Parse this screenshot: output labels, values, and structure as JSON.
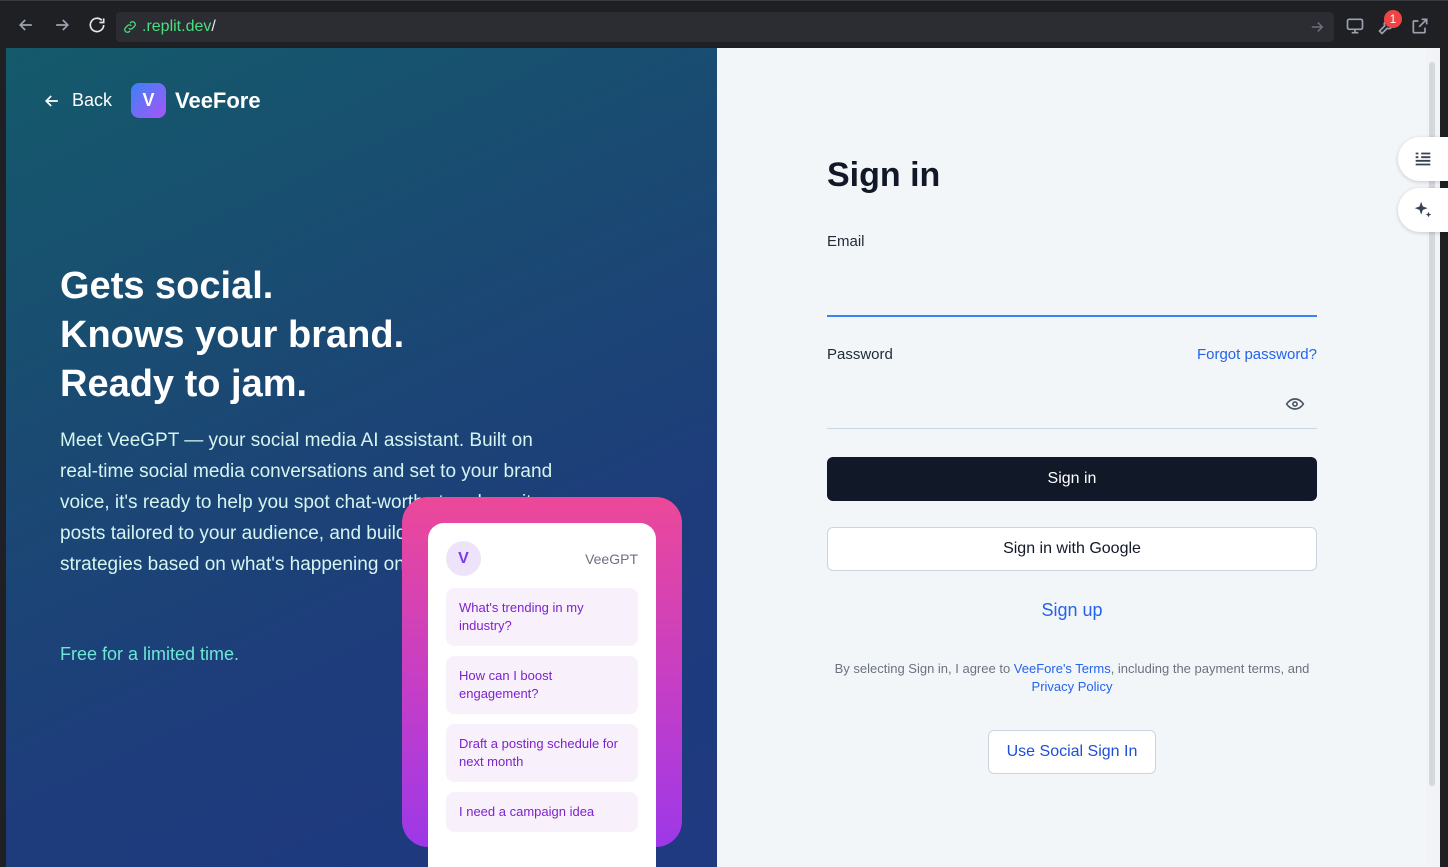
{
  "browser": {
    "url_host": ".replit.dev",
    "url_path": "/",
    "notification_count": "1"
  },
  "hero": {
    "back_label": "Back",
    "logo_letter": "V",
    "brand_name": "VeeFore",
    "headline_lines": [
      "Gets social.",
      "Knows your brand.",
      "Ready to jam."
    ],
    "description": "Meet VeeGPT — your social media AI assistant. Built on real-time social media conversations and set to your brand voice, it's ready to help you spot chat-worthy trends, write posts tailored to your audience, and build campaign strategies based on what's happening online right now.",
    "free_note": "Free for a limited time."
  },
  "chat": {
    "avatar_letter": "V",
    "assistant_name": "VeeGPT",
    "suggestions": [
      "What's trending in my industry?",
      "How can I boost engagement?",
      "Draft a posting schedule for next month",
      "I need a campaign idea"
    ]
  },
  "form": {
    "title": "Sign in",
    "email_label": "Email",
    "email_value": "",
    "password_label": "Password",
    "password_value": "",
    "forgot_link": "Forgot password?",
    "signin_button": "Sign in",
    "google_button": "Sign in with Google",
    "signup_link": "Sign up",
    "terms_prefix": "By selecting Sign in, I agree to ",
    "terms_link": "VeeFore's Terms",
    "terms_middle": ", including the payment terms, and ",
    "privacy_link": "Privacy Policy",
    "social_button": "Use Social Sign In"
  },
  "colors": {
    "primary_button": "#111827",
    "link": "#2563eb",
    "accent_teal": "#6ee7d5",
    "phone_gradient_start": "#ec4899",
    "phone_gradient_end": "#9d38e8"
  }
}
